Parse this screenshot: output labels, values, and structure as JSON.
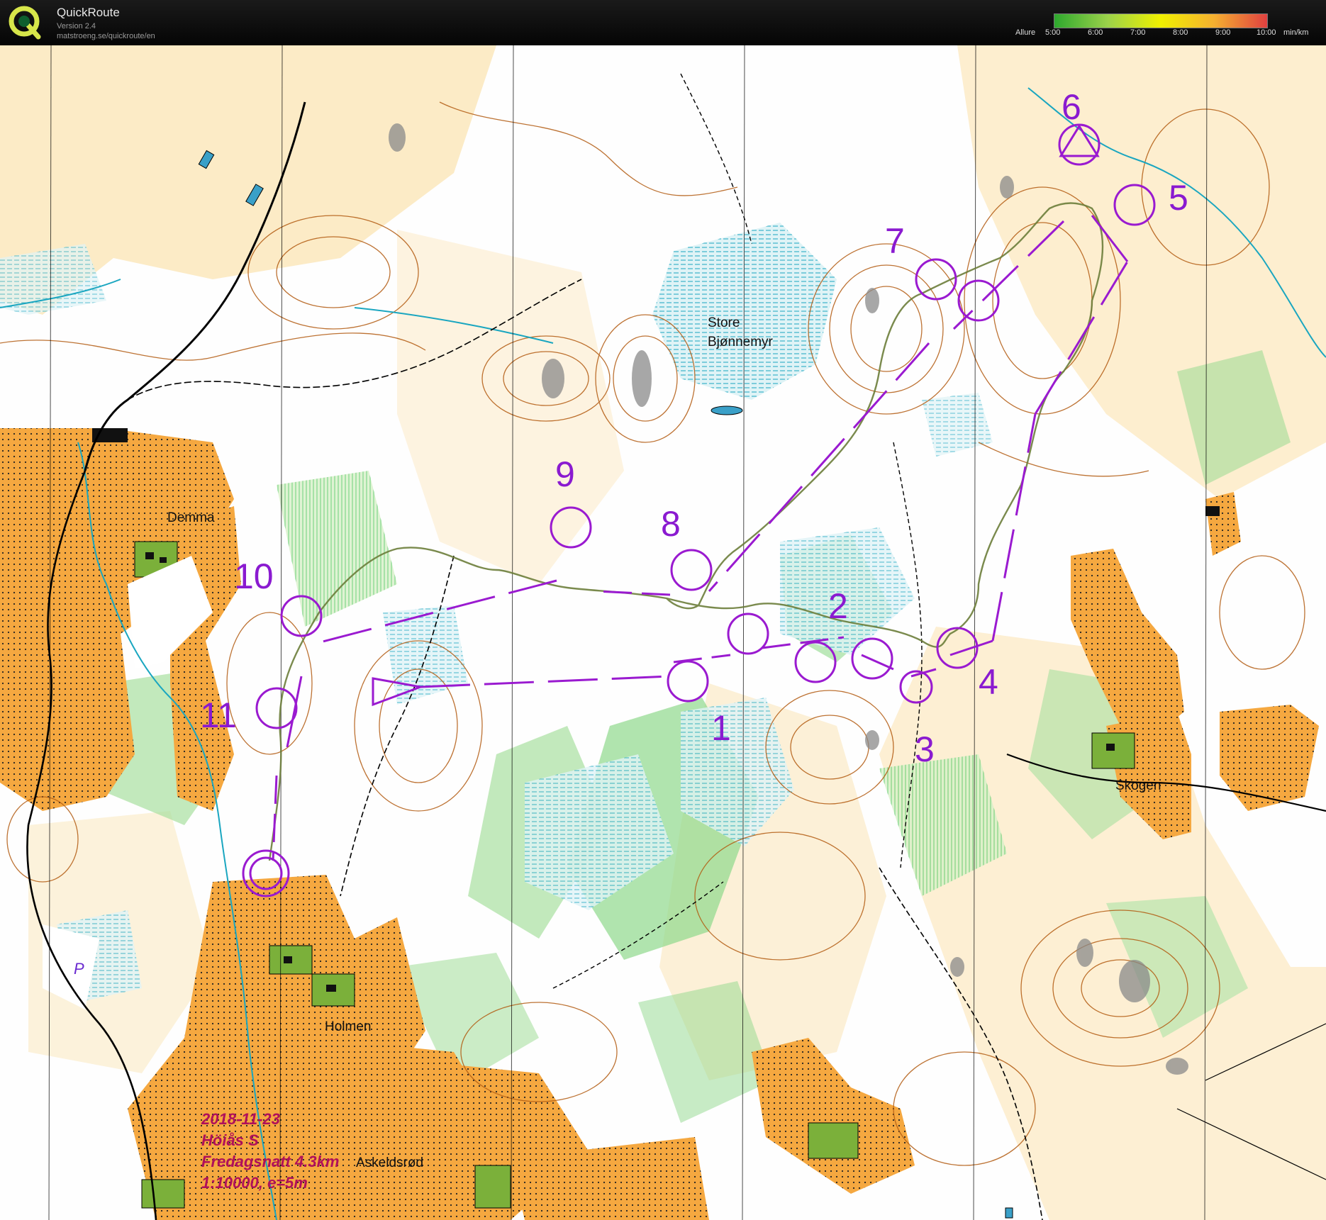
{
  "app": {
    "name": "QuickRoute",
    "version": "Version 2.4",
    "url": "matstroeng.se/quickroute/en"
  },
  "legend": {
    "label": "Allure",
    "ticks": [
      "5:00",
      "6:00",
      "7:00",
      "8:00",
      "9:00",
      "10:00"
    ],
    "unit": "min/km",
    "gradient_colors": [
      "#2ea82e",
      "#9bd24a",
      "#f0f000",
      "#f5b030",
      "#e04040"
    ]
  },
  "map": {
    "place_names": {
      "store": "Store",
      "bjonnemyr": "Bjønnemyr",
      "demma": "Demma",
      "skogen": "Skogen",
      "holmen": "Holmen",
      "askeldsrod": "Askeldsrød"
    },
    "controls": [
      "1",
      "2",
      "3",
      "4",
      "5",
      "6",
      "7",
      "8",
      "9",
      "10",
      "11"
    ],
    "info": {
      "date": "2018-11-23",
      "event": "Höiås S",
      "name": "Fredagsnatt 4.3km",
      "scale": "1:10000, e=5m"
    },
    "parking_symbol": "P",
    "colors": {
      "course": "#9a1ad0",
      "route": "#6b7d3a",
      "settlement": "#f5a840",
      "vegetation": "#49c45a",
      "marsh": "#1aa6c0",
      "contour": "#b25a10",
      "rough_open": "#fbe0a8"
    }
  }
}
